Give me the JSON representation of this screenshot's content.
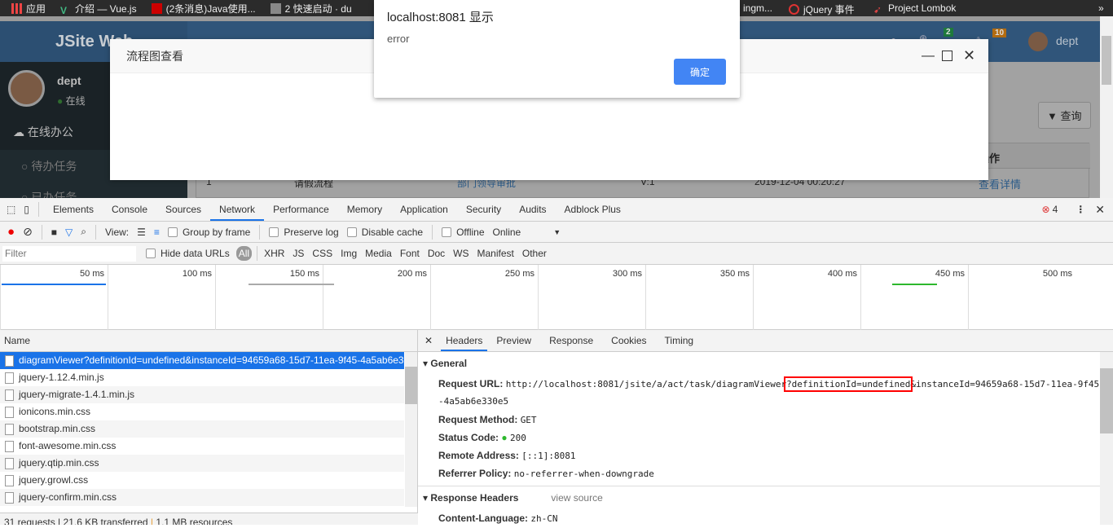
{
  "bookmarks": [
    "应用",
    "介绍 — Vue.js",
    "(2条消息)Java使用...",
    "2 快速启动 · du",
    "ingm...",
    "jQuery 事件",
    "Project Lombok"
  ],
  "app": {
    "logo": "JSite Web",
    "user": "dept",
    "status": "在线",
    "menu": [
      "在线办公",
      "待办任务",
      "已办任务"
    ],
    "badge_green": "2",
    "badge_orange": "10",
    "header_user": "dept",
    "query_button": "查询",
    "table_header_action": "操作",
    "row": {
      "index": "1",
      "name": "请假流程",
      "task": "部门领导审批",
      "version": "V:1",
      "time": "2019-12-04 00:20:27",
      "action": "查看详情"
    }
  },
  "layer": {
    "title": "流程图查看"
  },
  "alert": {
    "title": "localhost:8081 显示",
    "message": "error",
    "ok": "确定"
  },
  "devtools": {
    "tabs": [
      "Elements",
      "Console",
      "Sources",
      "Network",
      "Performance",
      "Memory",
      "Application",
      "Security",
      "Audits",
      "Adblock Plus"
    ],
    "active_tab": "Network",
    "error_count": "4",
    "toolbar": {
      "view": "View:",
      "group_by_frame": "Group by frame",
      "preserve_log": "Preserve log",
      "disable_cache": "Disable cache",
      "offline": "Offline",
      "online": "Online"
    },
    "filter": {
      "placeholder": "Filter",
      "hide_data_urls": "Hide data URLs",
      "types": [
        "All",
        "XHR",
        "JS",
        "CSS",
        "Img",
        "Media",
        "Font",
        "Doc",
        "WS",
        "Manifest",
        "Other"
      ]
    },
    "timeline_ticks": [
      "50 ms",
      "100 ms",
      "150 ms",
      "200 ms",
      "250 ms",
      "300 ms",
      "350 ms",
      "400 ms",
      "450 ms",
      "500 ms"
    ],
    "name_header": "Name",
    "requests": [
      "diagramViewer?definitionId=undefined&instanceId=94659a68-15d7-11ea-9f45-4a5ab6e330e5",
      "jquery-1.12.4.min.js",
      "jquery-migrate-1.4.1.min.js",
      "ionicons.min.css",
      "bootstrap.min.css",
      "font-awesome.min.css",
      "jquery.qtip.min.css",
      "jquery.growl.css",
      "jquery-confirm.min.css"
    ],
    "footer": {
      "requests": "31 requests",
      "transferred": "21.6 KB transferred",
      "resources": "1.1 MB resources"
    },
    "detail_tabs": [
      "Headers",
      "Preview",
      "Response",
      "Cookies",
      "Timing"
    ],
    "general": {
      "title": "General",
      "url_label": "Request URL:",
      "url_prefix": "http://localhost:8081/jsite/a/act/task/diagramViewer",
      "url_highlight": "?definitionId=undefined",
      "url_suffix": "&instanceId=94659a68-15d7-11ea-9f45",
      "url_wrap": "-4a5ab6e330e5",
      "method_label": "Request Method:",
      "method": "GET",
      "status_label": "Status Code:",
      "status": "200",
      "remote_label": "Remote Address:",
      "remote": "[::1]:8081",
      "referrer_label": "Referrer Policy:",
      "referrer": "no-referrer-when-downgrade"
    },
    "response_headers": {
      "title": "Response Headers",
      "view_source": "view source",
      "lang_label": "Content-Language:",
      "lang": "zh-CN"
    },
    "colors": {
      "accent": "#1a73e8",
      "highlight_box": "#ff0000",
      "status_ok": "#2eb82e",
      "alert_button": "#4285f4"
    }
  }
}
